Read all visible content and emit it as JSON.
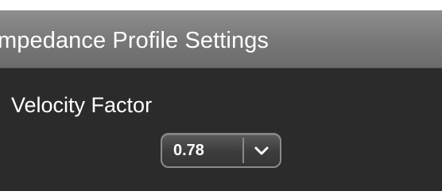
{
  "panel": {
    "title": "mpedance Profile Settings"
  },
  "velocity_factor": {
    "label": "Velocity Factor",
    "selected_value": "0.78",
    "arrow_icon": "chevron-down-icon"
  },
  "colors": {
    "panel_background": "#2b2b2b",
    "title_bar": "#777777",
    "text": "#ffffff",
    "dropdown_border": "#8a8a8a"
  }
}
